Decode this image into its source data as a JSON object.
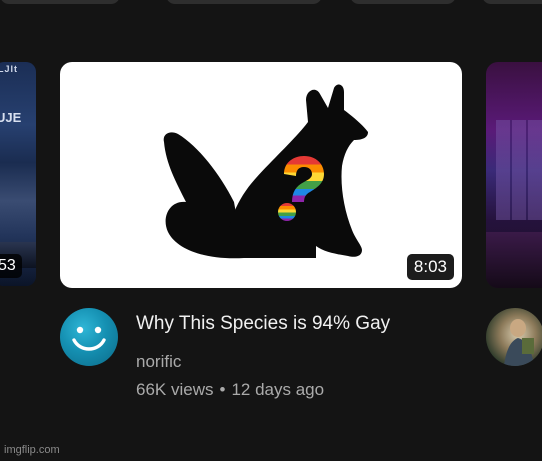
{
  "left_card": {
    "duration": "53",
    "overlay_text_top": "LJIt",
    "overlay_text_mid": "UJE"
  },
  "main_video": {
    "duration": "8:03",
    "title": "Why This Species is 94% Gay",
    "channel": "norific",
    "views": "66K views",
    "separator": "•",
    "age": "12 days ago",
    "thumbnail_colors": {
      "silhouette": "#0a0a0a",
      "background": "#ffffff",
      "rainbow": [
        "#e53935",
        "#fb8c00",
        "#fdd835",
        "#43a047",
        "#1e88e5",
        "#8e24aa"
      ]
    }
  },
  "watermark": "imgflip.com",
  "colors": {
    "page_bg": "#141414",
    "primary_text": "#f1f1f1",
    "secondary_text": "#aaaaaa"
  }
}
